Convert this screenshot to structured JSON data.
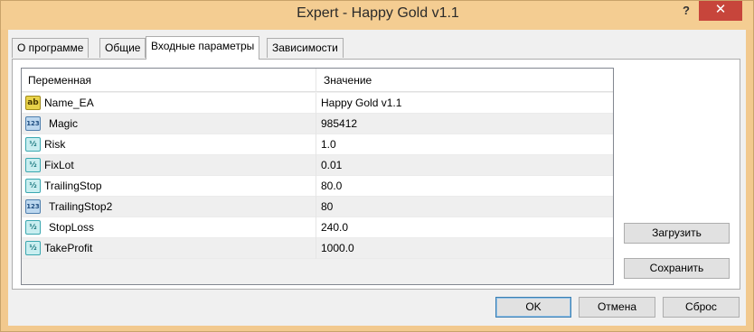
{
  "window": {
    "title": "Expert - Happy Gold v1.1",
    "help_label": "?",
    "close_label": "✕"
  },
  "tabs": [
    {
      "label": "О программе",
      "active": false
    },
    {
      "label": "Общие",
      "active": false
    },
    {
      "label": "Входные параметры",
      "active": true
    },
    {
      "label": "Зависимости",
      "active": false
    }
  ],
  "grid": {
    "columns": {
      "variable": "Переменная",
      "value": "Значение"
    },
    "rows": [
      {
        "icon": "string-icon",
        "icon_text": "ab",
        "name": "Name_EA",
        "value": "Happy Gold v1.1"
      },
      {
        "icon": "integer-icon",
        "icon_text": "123",
        "name": "Magic",
        "value": "985412"
      },
      {
        "icon": "double-icon",
        "icon_text": "½",
        "name": "Risk",
        "value": "1.0"
      },
      {
        "icon": "double-icon",
        "icon_text": "½",
        "name": "FixLot",
        "value": "0.01"
      },
      {
        "icon": "double-icon",
        "icon_text": "½",
        "name": "TrailingStop",
        "value": "80.0"
      },
      {
        "icon": "integer-icon",
        "icon_text": "123",
        "name": "TrailingStop2",
        "value": "80"
      },
      {
        "icon": "double-icon",
        "icon_text": "½",
        "name": "StopLoss",
        "value": "240.0"
      },
      {
        "icon": "double-icon",
        "icon_text": "½",
        "name": "TakeProfit",
        "value": "1000.0"
      }
    ]
  },
  "side_buttons": {
    "load": "Загрузить",
    "save": "Сохранить"
  },
  "footer_buttons": {
    "ok": "OK",
    "cancel": "Отмена",
    "reset": "Сброс"
  },
  "colors": {
    "frame": "#f2c98e",
    "close_button": "#c7453b"
  }
}
